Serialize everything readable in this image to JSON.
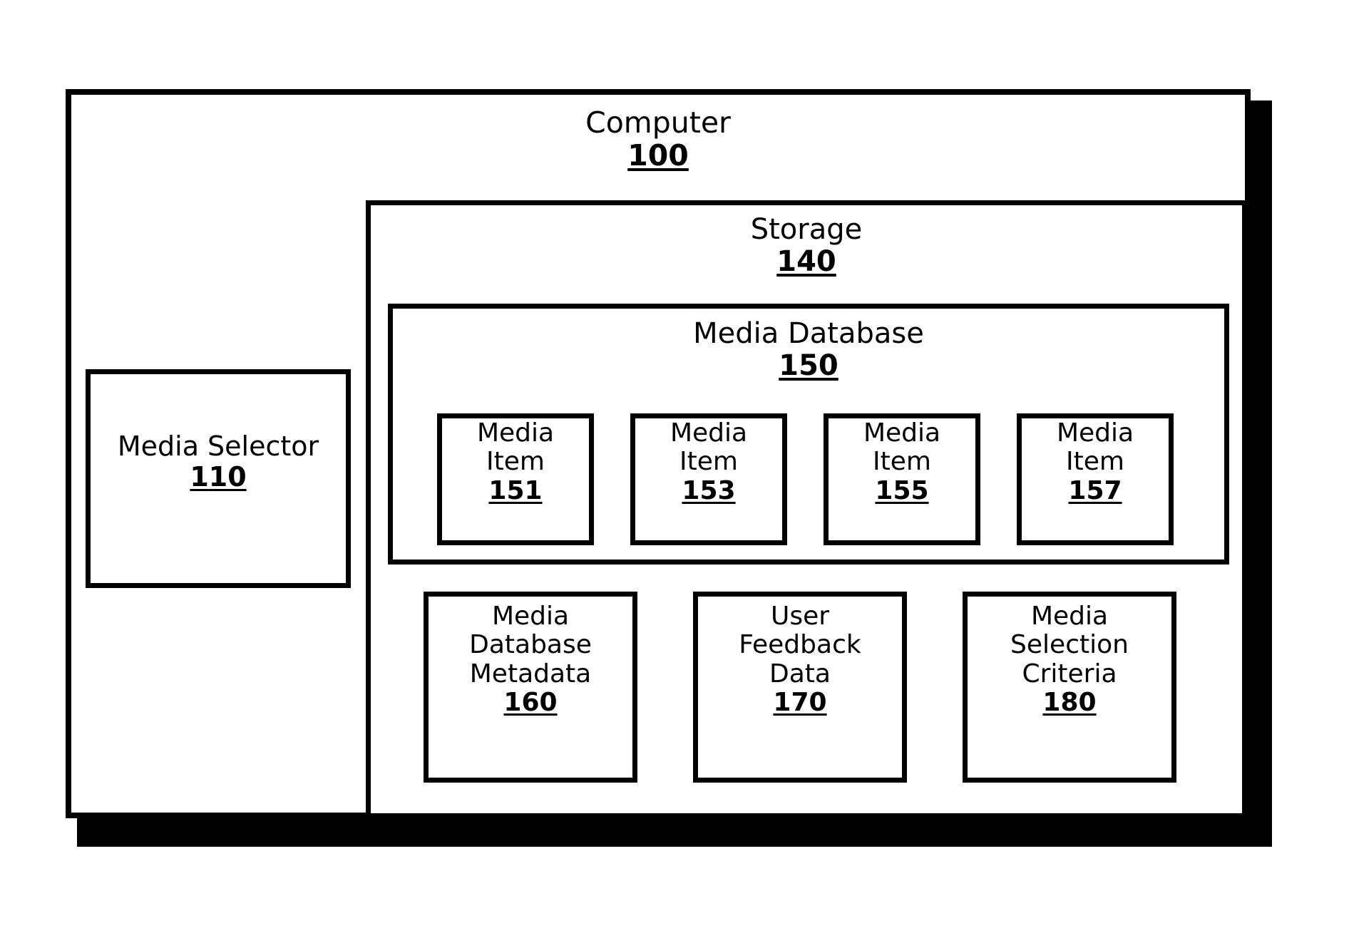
{
  "diagram": {
    "computer": {
      "label": "Computer",
      "ref": "100"
    },
    "media_selector": {
      "label": "Media Selector",
      "ref": "110"
    },
    "storage": {
      "label": "Storage",
      "ref": "140"
    },
    "media_database": {
      "label": "Media Database",
      "ref": "150"
    },
    "media_items": [
      {
        "label": "Media\nItem",
        "ref": "151"
      },
      {
        "label": "Media\nItem",
        "ref": "153"
      },
      {
        "label": "Media\nItem",
        "ref": "155"
      },
      {
        "label": "Media\nItem",
        "ref": "157"
      }
    ],
    "data_stores": [
      {
        "label": "Media\nDatabase\nMetadata",
        "ref": "160"
      },
      {
        "label": "User\nFeedback\nData",
        "ref": "170"
      },
      {
        "label": "Media\nSelection\nCriteria",
        "ref": "180"
      }
    ]
  },
  "colors": {
    "stroke": "#000000",
    "fill": "#ffffff",
    "shadow": "#000000"
  }
}
